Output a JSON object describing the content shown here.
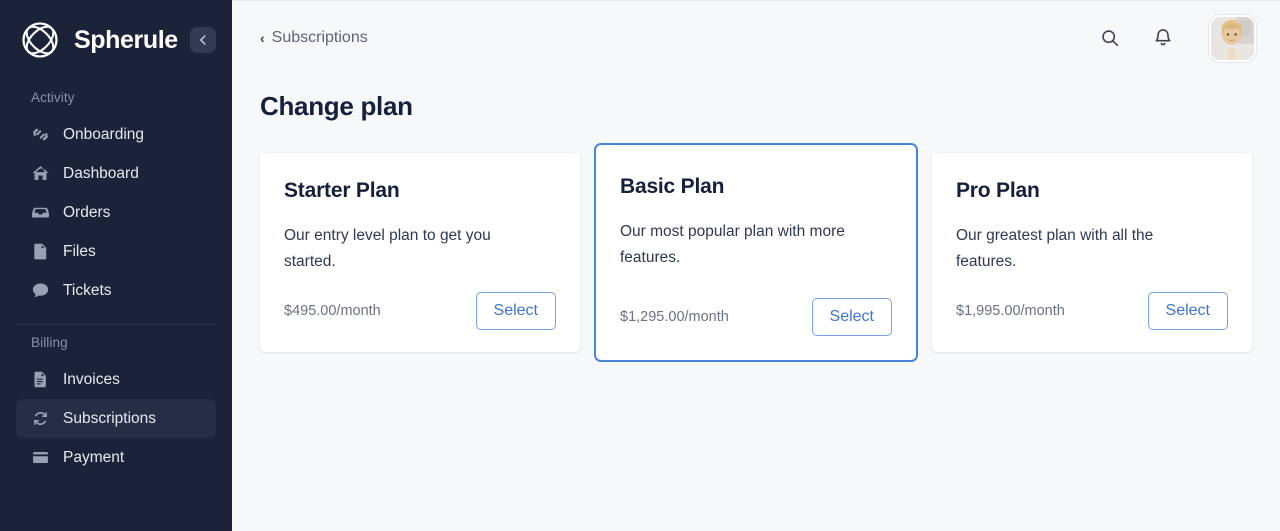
{
  "sidebar": {
    "brand": {
      "name": "Spherule",
      "logo_icon": "spherule-logo-icon"
    },
    "collapse_icon": "arrow-left-icon",
    "sections": [
      {
        "label": "Activity",
        "items": [
          {
            "label": "Onboarding",
            "icon": "handshake-icon",
            "active": false
          },
          {
            "label": "Dashboard",
            "icon": "home-icon",
            "active": false
          },
          {
            "label": "Orders",
            "icon": "inbox-tray-icon",
            "active": false
          },
          {
            "label": "Files",
            "icon": "file-icon",
            "active": false
          },
          {
            "label": "Tickets",
            "icon": "chat-bubble-icon",
            "active": false
          }
        ]
      },
      {
        "label": "Billing",
        "items": [
          {
            "label": "Invoices",
            "icon": "invoice-doc-icon",
            "active": false
          },
          {
            "label": "Subscriptions",
            "icon": "refresh-sync-icon",
            "active": true
          },
          {
            "label": "Payment",
            "icon": "credit-card-icon",
            "active": false
          }
        ]
      }
    ]
  },
  "topbar": {
    "breadcrumb_label": "Subscriptions",
    "breadcrumb_chevron": "‹",
    "search_icon": "search-icon",
    "notifications_icon": "bell-icon",
    "avatar_label": "user-avatar"
  },
  "page": {
    "title": "Change plan"
  },
  "plans": [
    {
      "name": "Starter Plan",
      "description": "Our entry level plan to get you started.",
      "price": "$495.00/month",
      "select_label": "Select",
      "featured": false
    },
    {
      "name": "Basic Plan",
      "description": "Our most popular plan with more features.",
      "price": "$1,295.00/month",
      "select_label": "Select",
      "featured": true
    },
    {
      "name": "Pro Plan",
      "description": "Our greatest plan with all the features.",
      "price": "$1,995.00/month",
      "select_label": "Select",
      "featured": false
    }
  ],
  "colors": {
    "sidebar_bg": "#1c2238",
    "sidebar_active_bg": "#262d45",
    "page_bg": "#f7f8fa",
    "card_bg": "#ffffff",
    "accent_blue": "#4a86d6",
    "button_blue": "#3f74d4",
    "heading": "#16203c"
  }
}
